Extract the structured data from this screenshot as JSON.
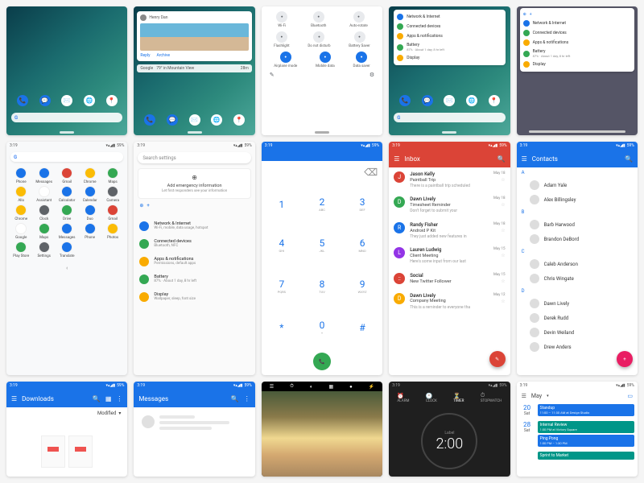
{
  "status": {
    "time": "3:19",
    "battery": "59%"
  },
  "notif": {
    "sender": "Henry Dan",
    "reply": "Reply",
    "archive": "Archive",
    "weather_src": "Google",
    "weather": "79° in Mountain View",
    "weather_time": "28m"
  },
  "qs": {
    "row1": [
      "Wi-Fi",
      "Bluetooth",
      "Auto-rotate"
    ],
    "row2": [
      "Flashlight",
      "Do not disturb",
      "Battery Saver"
    ],
    "row3": [
      "Airplane mode",
      "Mobile data",
      "Data saver"
    ]
  },
  "settings_panel": {
    "items": [
      {
        "label": "Network & Internet",
        "sub": "",
        "color": "#1a73e8"
      },
      {
        "label": "Connected devices",
        "sub": "",
        "color": "#34a853"
      },
      {
        "label": "Apps & notifications",
        "sub": "",
        "color": "#f9ab00"
      },
      {
        "label": "Battery",
        "sub": "87% · About 1 day, 8 hr left",
        "color": "#34a853"
      },
      {
        "label": "Display",
        "sub": "",
        "color": "#f9ab00"
      }
    ]
  },
  "apps": [
    {
      "n": "Phone",
      "c": "#1a73e8"
    },
    {
      "n": "Messages",
      "c": "#1a73e8"
    },
    {
      "n": "Gmail",
      "c": "#db4437"
    },
    {
      "n": "Chrome",
      "c": "#fbbc05"
    },
    {
      "n": "Maps",
      "c": "#34a853"
    },
    {
      "n": "Allo",
      "c": "#fbbc05"
    },
    {
      "n": "Assistant",
      "c": "#fff"
    },
    {
      "n": "Calculator",
      "c": "#1a73e8"
    },
    {
      "n": "Calendar",
      "c": "#1a73e8"
    },
    {
      "n": "Camera",
      "c": "#5f6368"
    },
    {
      "n": "Chrome",
      "c": "#fbbc05"
    },
    {
      "n": "Clock",
      "c": "#5f6368"
    },
    {
      "n": "Drive",
      "c": "#34a853"
    },
    {
      "n": "Duo",
      "c": "#1a73e8"
    },
    {
      "n": "Gmail",
      "c": "#db4437"
    },
    {
      "n": "Google",
      "c": "#fff"
    },
    {
      "n": "Maps",
      "c": "#34a853"
    },
    {
      "n": "Messages",
      "c": "#1a73e8"
    },
    {
      "n": "Phone",
      "c": "#1a73e8"
    },
    {
      "n": "Photos",
      "c": "#fbbc05"
    },
    {
      "n": "Play Store",
      "c": "#34a853"
    },
    {
      "n": "Settings",
      "c": "#5f6368"
    },
    {
      "n": "Translate",
      "c": "#1a73e8"
    }
  ],
  "search_settings": {
    "placeholder": "Search settings",
    "emergency_title": "Add emergency information",
    "emergency_sub": "Let first responders see your information",
    "items": [
      {
        "label": "Network & Internet",
        "sub": "Wi-Fi, mobile, data usage, hotspot",
        "color": "#1a73e8"
      },
      {
        "label": "Connected devices",
        "sub": "Bluetooth, NFC",
        "color": "#34a853"
      },
      {
        "label": "Apps & notifications",
        "sub": "Permissions, default apps",
        "color": "#f9ab00"
      },
      {
        "label": "Battery",
        "sub": "87% · About 1 day, 8 hr left",
        "color": "#34a853"
      },
      {
        "label": "Display",
        "sub": "Wallpaper, sleep, font size",
        "color": "#f9ab00"
      }
    ]
  },
  "dialer_keys": [
    [
      "1",
      ""
    ],
    [
      "2",
      "ABC"
    ],
    [
      "3",
      "DEF"
    ],
    [
      "4",
      "GHI"
    ],
    [
      "5",
      "JKL"
    ],
    [
      "6",
      "MNO"
    ],
    [
      "7",
      "PQRS"
    ],
    [
      "8",
      "TUV"
    ],
    [
      "9",
      "WXYZ"
    ],
    [
      "*",
      ""
    ],
    [
      "0",
      "+"
    ],
    [
      "#",
      ""
    ]
  ],
  "inbox": {
    "title": "Inbox",
    "items": [
      {
        "from": "Jason Kelly",
        "sub": "Paintball Trip",
        "prev": "There is a paintball trip scheduled",
        "date": "May 18",
        "av": "J",
        "c": "#db4437"
      },
      {
        "from": "Dawn Lively",
        "sub": "Timesheet Reminder",
        "prev": "Don't forget to submit your",
        "date": "May 18",
        "av": "D",
        "c": "#34a853"
      },
      {
        "from": "Randy Fisher",
        "sub": "Android P Kit",
        "prev": "They just added new features in",
        "date": "May 18",
        "av": "R",
        "c": "#1a73e8"
      },
      {
        "from": "Lauren Ludwig",
        "sub": "Client Meeting",
        "prev": "Here's some input from our last",
        "date": "May 15",
        "av": "L",
        "c": "#9334e6"
      },
      {
        "from": "Social",
        "sub": "New Twitter Follower",
        "prev": "",
        "date": "May 15",
        "av": "::",
        "c": "#db4437"
      },
      {
        "from": "Dawn Lively",
        "sub": "Company Meeting",
        "prev": "This is a reminder to everyone tha",
        "date": "May 12",
        "av": "D",
        "c": "#f9ab00"
      }
    ]
  },
  "contacts": {
    "title": "Contacts",
    "sections": [
      {
        "letter": "A",
        "names": [
          "Adam Yale",
          "Alex Billingsley"
        ]
      },
      {
        "letter": "B",
        "names": [
          "Barb Harwood",
          "Brandon DeBord"
        ]
      },
      {
        "letter": "C",
        "names": [
          "Caleb Anderson",
          "Chris Wingate"
        ]
      },
      {
        "letter": "D",
        "names": [
          "Dawn Lively",
          "Derek Rudd",
          "Devin Weiland",
          "Drew Anders"
        ]
      }
    ]
  },
  "downloads": {
    "title": "Downloads",
    "sort": "Modified"
  },
  "messages": {
    "title": "Messages"
  },
  "clock": {
    "tabs": [
      "ALARM",
      "CLOCK",
      "TIMER",
      "STOPWATCH"
    ],
    "active": 2,
    "label": "Label",
    "time": "2:00"
  },
  "calendar": {
    "month": "May",
    "days": [
      {
        "num": "20",
        "dow": "Sat",
        "events": [
          {
            "t": "Standup",
            "sub": "11:00 – 11:30 AM at Design Studio",
            "c": "blue"
          }
        ]
      },
      {
        "num": "28",
        "dow": "Sat",
        "events": [
          {
            "t": "Internal Review",
            "sub": "1:00 PM at Victory Square",
            "c": "teal"
          },
          {
            "t": "Ping Pong",
            "sub": "1:00 PM – 1:30 PM",
            "c": "blue"
          }
        ]
      }
    ],
    "more": "Sprint to Market"
  }
}
